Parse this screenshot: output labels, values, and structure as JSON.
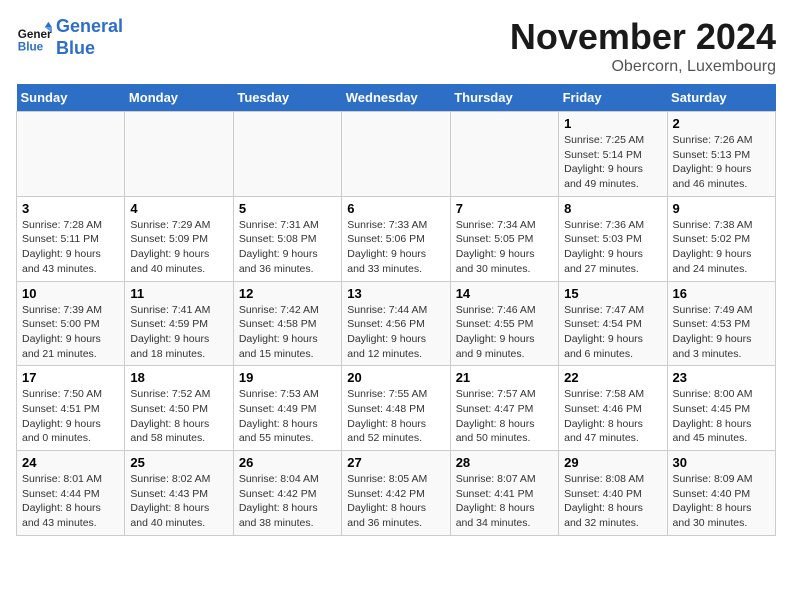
{
  "logo": {
    "text_general": "General",
    "text_blue": "Blue"
  },
  "title": {
    "month": "November 2024",
    "location": "Obercorn, Luxembourg"
  },
  "weekdays": [
    "Sunday",
    "Monday",
    "Tuesday",
    "Wednesday",
    "Thursday",
    "Friday",
    "Saturday"
  ],
  "weeks": [
    [
      {
        "day": "",
        "info": ""
      },
      {
        "day": "",
        "info": ""
      },
      {
        "day": "",
        "info": ""
      },
      {
        "day": "",
        "info": ""
      },
      {
        "day": "",
        "info": ""
      },
      {
        "day": "1",
        "info": "Sunrise: 7:25 AM\nSunset: 5:14 PM\nDaylight: 9 hours and 49 minutes."
      },
      {
        "day": "2",
        "info": "Sunrise: 7:26 AM\nSunset: 5:13 PM\nDaylight: 9 hours and 46 minutes."
      }
    ],
    [
      {
        "day": "3",
        "info": "Sunrise: 7:28 AM\nSunset: 5:11 PM\nDaylight: 9 hours and 43 minutes."
      },
      {
        "day": "4",
        "info": "Sunrise: 7:29 AM\nSunset: 5:09 PM\nDaylight: 9 hours and 40 minutes."
      },
      {
        "day": "5",
        "info": "Sunrise: 7:31 AM\nSunset: 5:08 PM\nDaylight: 9 hours and 36 minutes."
      },
      {
        "day": "6",
        "info": "Sunrise: 7:33 AM\nSunset: 5:06 PM\nDaylight: 9 hours and 33 minutes."
      },
      {
        "day": "7",
        "info": "Sunrise: 7:34 AM\nSunset: 5:05 PM\nDaylight: 9 hours and 30 minutes."
      },
      {
        "day": "8",
        "info": "Sunrise: 7:36 AM\nSunset: 5:03 PM\nDaylight: 9 hours and 27 minutes."
      },
      {
        "day": "9",
        "info": "Sunrise: 7:38 AM\nSunset: 5:02 PM\nDaylight: 9 hours and 24 minutes."
      }
    ],
    [
      {
        "day": "10",
        "info": "Sunrise: 7:39 AM\nSunset: 5:00 PM\nDaylight: 9 hours and 21 minutes."
      },
      {
        "day": "11",
        "info": "Sunrise: 7:41 AM\nSunset: 4:59 PM\nDaylight: 9 hours and 18 minutes."
      },
      {
        "day": "12",
        "info": "Sunrise: 7:42 AM\nSunset: 4:58 PM\nDaylight: 9 hours and 15 minutes."
      },
      {
        "day": "13",
        "info": "Sunrise: 7:44 AM\nSunset: 4:56 PM\nDaylight: 9 hours and 12 minutes."
      },
      {
        "day": "14",
        "info": "Sunrise: 7:46 AM\nSunset: 4:55 PM\nDaylight: 9 hours and 9 minutes."
      },
      {
        "day": "15",
        "info": "Sunrise: 7:47 AM\nSunset: 4:54 PM\nDaylight: 9 hours and 6 minutes."
      },
      {
        "day": "16",
        "info": "Sunrise: 7:49 AM\nSunset: 4:53 PM\nDaylight: 9 hours and 3 minutes."
      }
    ],
    [
      {
        "day": "17",
        "info": "Sunrise: 7:50 AM\nSunset: 4:51 PM\nDaylight: 9 hours and 0 minutes."
      },
      {
        "day": "18",
        "info": "Sunrise: 7:52 AM\nSunset: 4:50 PM\nDaylight: 8 hours and 58 minutes."
      },
      {
        "day": "19",
        "info": "Sunrise: 7:53 AM\nSunset: 4:49 PM\nDaylight: 8 hours and 55 minutes."
      },
      {
        "day": "20",
        "info": "Sunrise: 7:55 AM\nSunset: 4:48 PM\nDaylight: 8 hours and 52 minutes."
      },
      {
        "day": "21",
        "info": "Sunrise: 7:57 AM\nSunset: 4:47 PM\nDaylight: 8 hours and 50 minutes."
      },
      {
        "day": "22",
        "info": "Sunrise: 7:58 AM\nSunset: 4:46 PM\nDaylight: 8 hours and 47 minutes."
      },
      {
        "day": "23",
        "info": "Sunrise: 8:00 AM\nSunset: 4:45 PM\nDaylight: 8 hours and 45 minutes."
      }
    ],
    [
      {
        "day": "24",
        "info": "Sunrise: 8:01 AM\nSunset: 4:44 PM\nDaylight: 8 hours and 43 minutes."
      },
      {
        "day": "25",
        "info": "Sunrise: 8:02 AM\nSunset: 4:43 PM\nDaylight: 8 hours and 40 minutes."
      },
      {
        "day": "26",
        "info": "Sunrise: 8:04 AM\nSunset: 4:42 PM\nDaylight: 8 hours and 38 minutes."
      },
      {
        "day": "27",
        "info": "Sunrise: 8:05 AM\nSunset: 4:42 PM\nDaylight: 8 hours and 36 minutes."
      },
      {
        "day": "28",
        "info": "Sunrise: 8:07 AM\nSunset: 4:41 PM\nDaylight: 8 hours and 34 minutes."
      },
      {
        "day": "29",
        "info": "Sunrise: 8:08 AM\nSunset: 4:40 PM\nDaylight: 8 hours and 32 minutes."
      },
      {
        "day": "30",
        "info": "Sunrise: 8:09 AM\nSunset: 4:40 PM\nDaylight: 8 hours and 30 minutes."
      }
    ]
  ]
}
